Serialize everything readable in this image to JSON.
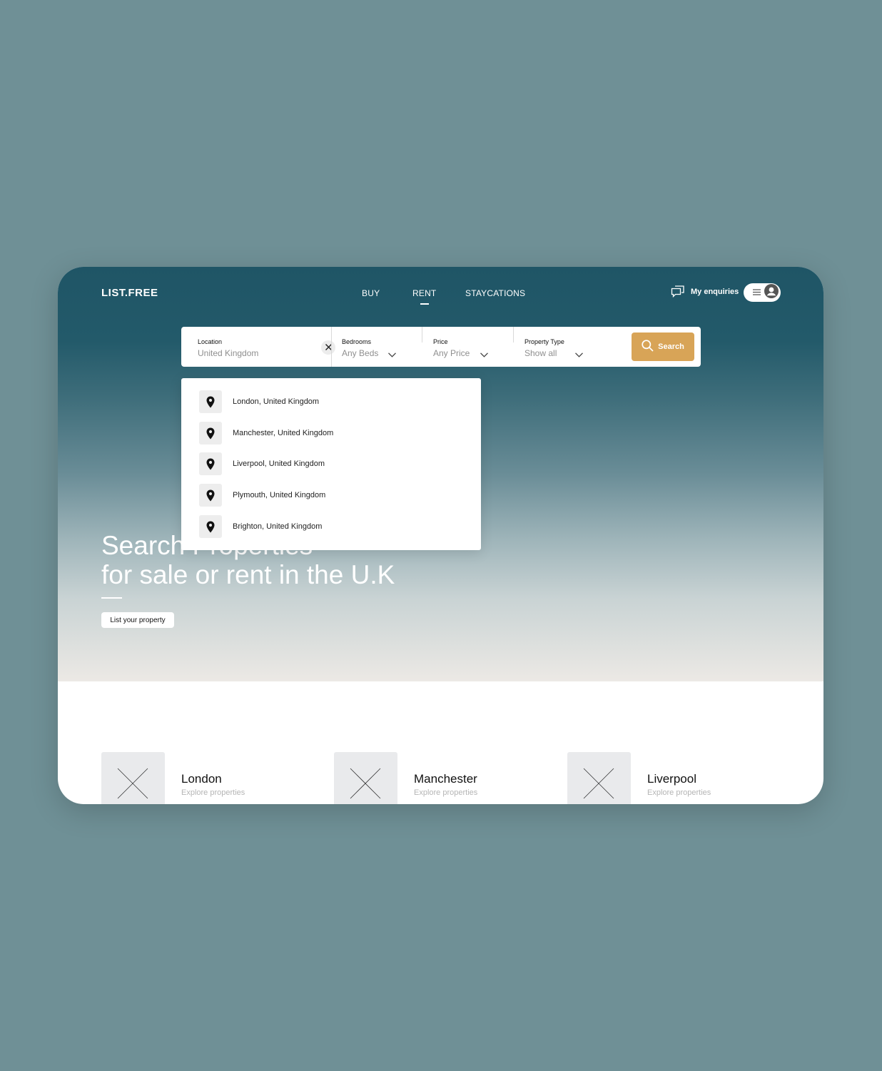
{
  "app": {
    "logo": "LIST.FREE"
  },
  "nav": {
    "items": [
      {
        "label": "BUY"
      },
      {
        "label": "RENT",
        "active": true
      },
      {
        "label": "STAYCATIONS"
      }
    ]
  },
  "header": {
    "enquiries_label": "My enquiries"
  },
  "search": {
    "location": {
      "label": "Location",
      "value": "United Kingdom"
    },
    "bedrooms": {
      "label": "Bedrooms",
      "value": "Any Beds"
    },
    "price": {
      "label": "Price",
      "value": "Any Price"
    },
    "property_type": {
      "label": "Property Type",
      "value": "Show all"
    },
    "button_label": "Search"
  },
  "suggestions": [
    "London, United Kingdom",
    "Manchester, United Kingdom",
    "Liverpool, United Kingdom",
    "Plymouth, United Kingdom",
    "Brighton, United Kingdom"
  ],
  "hero": {
    "line1": "Search Properties",
    "line2": "for sale or rent in the U.K",
    "cta_label": "List your property"
  },
  "cities": [
    {
      "name": "London",
      "subtitle": "Explore properties"
    },
    {
      "name": "Manchester",
      "subtitle": "Explore properties"
    },
    {
      "name": "Liverpool",
      "subtitle": "Explore properties"
    }
  ],
  "colors": {
    "page_background": "#6f9096",
    "hero_top": "#1f5566",
    "search_button": "#d8a457"
  },
  "icons": {
    "enquiries": "chat-bubbles-icon",
    "menu": "hamburger-icon",
    "user": "user-avatar-icon",
    "clear": "close-icon",
    "dropdown": "chevron-down-icon",
    "search": "search-icon",
    "suggestion": "map-pin-icon",
    "placeholder": "image-placeholder-icon"
  }
}
